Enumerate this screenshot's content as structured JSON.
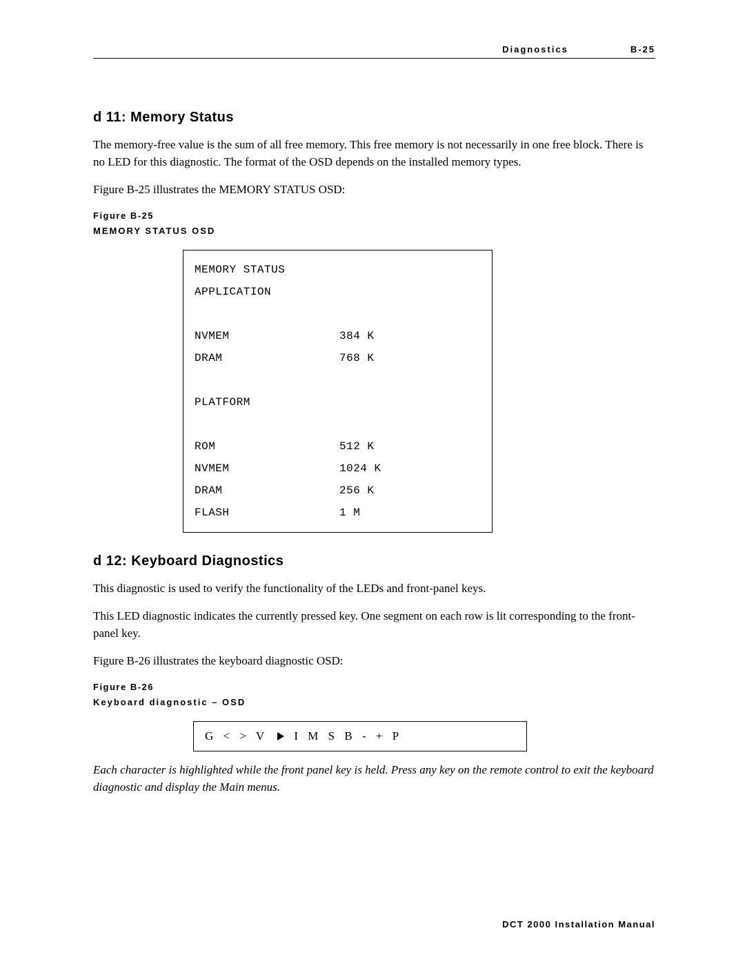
{
  "header": {
    "section": "Diagnostics",
    "page": "B-25"
  },
  "section1": {
    "heading": "d 11: Memory Status",
    "para1": "The memory-free value is the sum of all free memory. This free memory is not necessarily in one free block. There is no LED for this diagnostic. The format of the OSD depends on the installed memory types.",
    "para2": "Figure B-25 illustrates the MEMORY STATUS OSD:"
  },
  "figure25": {
    "label": "Figure B-25",
    "caption": "MEMORY STATUS OSD",
    "osd": {
      "title": "MEMORY STATUS",
      "group1_title": "APPLICATION",
      "group2_title": "PLATFORM",
      "app_rows": [
        {
          "label": "NVMEM",
          "value": "384 K"
        },
        {
          "label": "DRAM",
          "value": "768 K"
        }
      ],
      "plat_rows": [
        {
          "label": "ROM",
          "value": "512 K"
        },
        {
          "label": "NVMEM",
          "value": "1024 K"
        },
        {
          "label": "DRAM",
          "value": "256 K"
        },
        {
          "label": "FLASH",
          "value": "1 M"
        }
      ]
    }
  },
  "section2": {
    "heading": "d 12: Keyboard Diagnostics",
    "para1": "This diagnostic is used to verify the functionality of the LEDs and front-panel keys.",
    "para2": "This LED diagnostic indicates the currently pressed key. One segment on each row is lit corresponding to the front-panel key.",
    "para3": "Figure B-26 illustrates the keyboard diagnostic OSD:"
  },
  "figure26": {
    "label": "Figure B-26",
    "caption": "Keyboard diagnostic – OSD",
    "osd": {
      "segA": "G  <  >  V ",
      "segB": " I M  S  B  -  +  P"
    },
    "note": "Each character is highlighted while the front panel key is held. Press any key on the remote control to exit the keyboard diagnostic and display the Main menus."
  },
  "footer": "DCT 2000 Installation Manual"
}
